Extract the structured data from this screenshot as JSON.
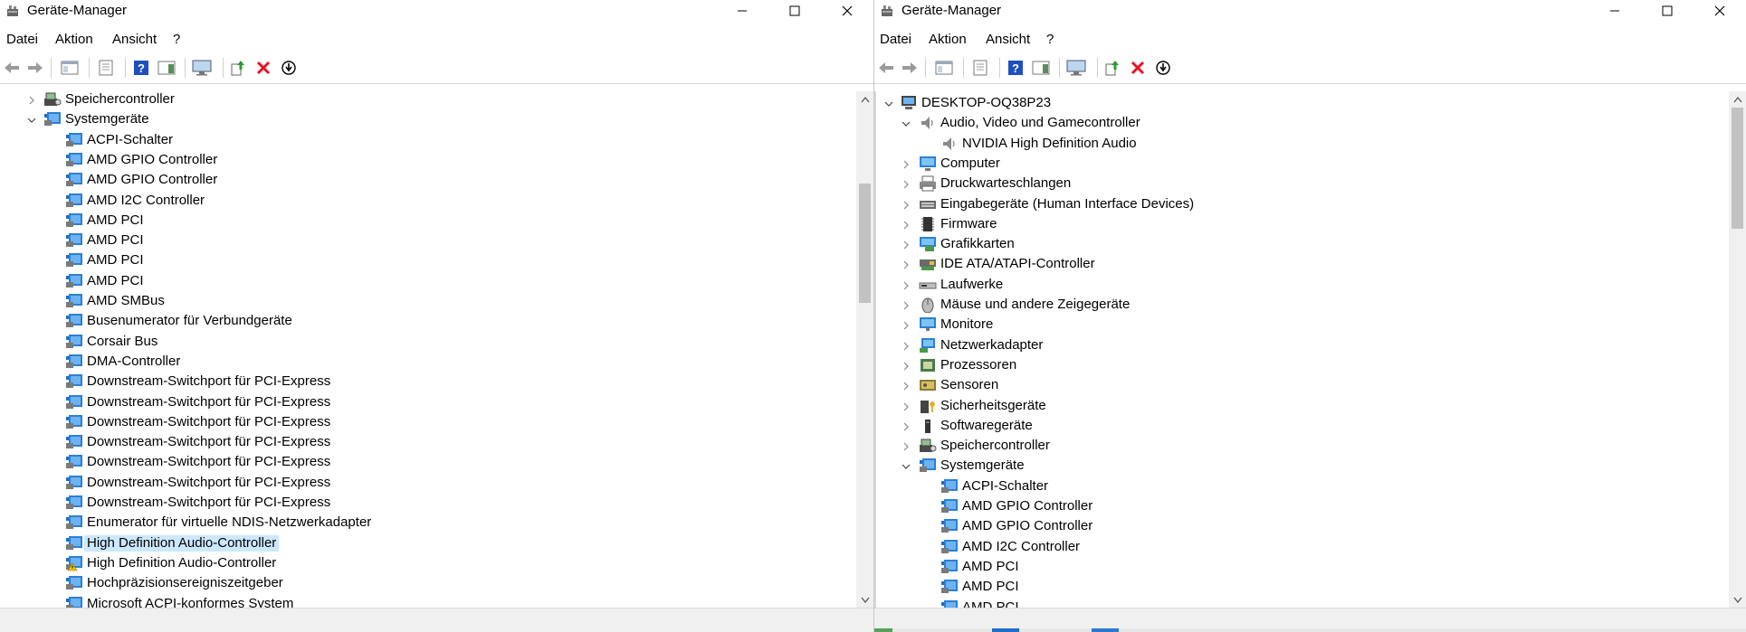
{
  "left": {
    "title": "Geräte-Manager",
    "menu": [
      "Datei",
      "Aktion",
      "Ansicht",
      "?"
    ],
    "tree": [
      {
        "label": "Speichercontroller",
        "level": 1,
        "state": "collapsed",
        "icon": "storage-controller-icon"
      },
      {
        "label": "Systemgeräte",
        "level": 1,
        "state": "expanded",
        "icon": "system-devices-icon"
      },
      {
        "label": "ACPI-Schalter",
        "level": 2,
        "icon": "system-device-icon"
      },
      {
        "label": "AMD GPIO Controller",
        "level": 2,
        "icon": "system-device-icon"
      },
      {
        "label": "AMD GPIO Controller",
        "level": 2,
        "icon": "system-device-icon"
      },
      {
        "label": "AMD I2C Controller",
        "level": 2,
        "icon": "system-device-icon"
      },
      {
        "label": "AMD PCI",
        "level": 2,
        "icon": "system-device-icon"
      },
      {
        "label": "AMD PCI",
        "level": 2,
        "icon": "system-device-icon"
      },
      {
        "label": "AMD PCI",
        "level": 2,
        "icon": "system-device-icon"
      },
      {
        "label": "AMD PCI",
        "level": 2,
        "icon": "system-device-icon"
      },
      {
        "label": "AMD SMBus",
        "level": 2,
        "icon": "system-device-icon"
      },
      {
        "label": "Busenumerator für Verbundgeräte",
        "level": 2,
        "icon": "system-device-icon"
      },
      {
        "label": "Corsair Bus",
        "level": 2,
        "icon": "system-device-icon"
      },
      {
        "label": "DMA-Controller",
        "level": 2,
        "icon": "system-device-icon"
      },
      {
        "label": "Downstream-Switchport für PCI-Express",
        "level": 2,
        "icon": "system-device-icon"
      },
      {
        "label": "Downstream-Switchport für PCI-Express",
        "level": 2,
        "icon": "system-device-icon"
      },
      {
        "label": "Downstream-Switchport für PCI-Express",
        "level": 2,
        "icon": "system-device-icon"
      },
      {
        "label": "Downstream-Switchport für PCI-Express",
        "level": 2,
        "icon": "system-device-icon"
      },
      {
        "label": "Downstream-Switchport für PCI-Express",
        "level": 2,
        "icon": "system-device-icon"
      },
      {
        "label": "Downstream-Switchport für PCI-Express",
        "level": 2,
        "icon": "system-device-icon"
      },
      {
        "label": "Downstream-Switchport für PCI-Express",
        "level": 2,
        "icon": "system-device-icon"
      },
      {
        "label": "Enumerator für virtuelle NDIS-Netzwerkadapter",
        "level": 2,
        "icon": "system-device-icon"
      },
      {
        "label": "High Definition Audio-Controller",
        "level": 2,
        "icon": "system-device-icon",
        "selected": true
      },
      {
        "label": "High Definition Audio-Controller",
        "level": 2,
        "icon": "system-device-warning-icon"
      },
      {
        "label": "Hochpräzisionsereigniszeitgeber",
        "level": 2,
        "icon": "system-device-icon"
      },
      {
        "label": "Microsoft ACPI-konformes System",
        "level": 2,
        "icon": "system-device-icon"
      }
    ]
  },
  "right": {
    "title": "Geräte-Manager",
    "menu": [
      "Datei",
      "Aktion",
      "Ansicht",
      "?"
    ],
    "tree": [
      {
        "label": "DESKTOP-OQ38P23",
        "level": 0,
        "state": "expanded",
        "icon": "computer-root-icon"
      },
      {
        "label": "Audio, Video und Gamecontroller",
        "level": 1,
        "state": "expanded",
        "icon": "speaker-icon"
      },
      {
        "label": "NVIDIA High Definition Audio",
        "level": 2,
        "icon": "speaker-icon"
      },
      {
        "label": "Computer",
        "level": 1,
        "state": "collapsed",
        "icon": "computer-icon"
      },
      {
        "label": "Druckwarteschlangen",
        "level": 1,
        "state": "collapsed",
        "icon": "printer-icon"
      },
      {
        "label": "Eingabegeräte (Human Interface Devices)",
        "level": 1,
        "state": "collapsed",
        "icon": "keyboard-icon"
      },
      {
        "label": "Firmware",
        "level": 1,
        "state": "collapsed",
        "icon": "firmware-icon"
      },
      {
        "label": "Grafikkarten",
        "level": 1,
        "state": "collapsed",
        "icon": "display-adapter-icon"
      },
      {
        "label": "IDE ATA/ATAPI-Controller",
        "level": 1,
        "state": "collapsed",
        "icon": "ide-controller-icon"
      },
      {
        "label": "Laufwerke",
        "level": 1,
        "state": "collapsed",
        "icon": "disk-drive-icon"
      },
      {
        "label": "Mäuse und andere Zeigegeräte",
        "level": 1,
        "state": "collapsed",
        "icon": "mouse-icon"
      },
      {
        "label": "Monitore",
        "level": 1,
        "state": "collapsed",
        "icon": "monitor-icon"
      },
      {
        "label": "Netzwerkadapter",
        "level": 1,
        "state": "collapsed",
        "icon": "network-adapter-icon"
      },
      {
        "label": "Prozessoren",
        "level": 1,
        "state": "collapsed",
        "icon": "processor-icon"
      },
      {
        "label": "Sensoren",
        "level": 1,
        "state": "collapsed",
        "icon": "sensor-icon"
      },
      {
        "label": "Sicherheitsgeräte",
        "level": 1,
        "state": "collapsed",
        "icon": "security-device-icon"
      },
      {
        "label": "Softwaregeräte",
        "level": 1,
        "state": "collapsed",
        "icon": "software-device-icon"
      },
      {
        "label": "Speichercontroller",
        "level": 1,
        "state": "collapsed",
        "icon": "storage-controller-icon"
      },
      {
        "label": "Systemgeräte",
        "level": 1,
        "state": "expanded",
        "icon": "system-devices-icon"
      },
      {
        "label": "ACPI-Schalter",
        "level": 2,
        "icon": "system-device-icon"
      },
      {
        "label": "AMD GPIO Controller",
        "level": 2,
        "icon": "system-device-icon"
      },
      {
        "label": "AMD GPIO Controller",
        "level": 2,
        "icon": "system-device-icon"
      },
      {
        "label": "AMD I2C Controller",
        "level": 2,
        "icon": "system-device-icon"
      },
      {
        "label": "AMD PCI",
        "level": 2,
        "icon": "system-device-icon"
      },
      {
        "label": "AMD PCI",
        "level": 2,
        "icon": "system-device-icon"
      },
      {
        "label": "AMD PCI",
        "level": 2,
        "icon": "system-device-icon"
      }
    ]
  },
  "colors": {
    "selection": "#cce8ff",
    "delete": "#e81123",
    "help": "#1f4fbf"
  }
}
